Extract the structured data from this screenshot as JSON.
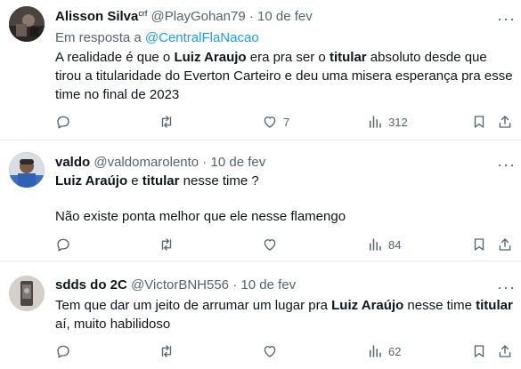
{
  "posts": [
    {
      "name": "Alisson Silva",
      "name_sup": "crf",
      "handle": "@PlayGohan79",
      "dot": "·",
      "date": "10 de fev",
      "reply_prefix": "Em resposta a",
      "reply_to": "@CentralFlaNacao",
      "text_1": "A realidade é que o ",
      "bold_1": "Luiz Araujo",
      "text_2": " era pra ser o ",
      "bold_2": "titular",
      "text_3": " absoluto desde que tirou a titularidade do Everton Carteiro e deu uma misera esperança pra esse time no final de 2023",
      "likes": "7",
      "views": "312"
    },
    {
      "name": "valdo",
      "handle": "@valdomarolento",
      "dot": "·",
      "date": "10 de fev",
      "bold_1": "Luiz Araújo",
      "text_1": " e ",
      "bold_2": "titular",
      "text_2": " nesse time ?",
      "text_3": "Não existe ponta melhor que ele nesse flamengo",
      "views": "84"
    },
    {
      "name": "sdds do 2C",
      "handle": "@VictorBNH556",
      "dot": "·",
      "date": "10 de fev",
      "text_1": "Tem que dar um jeito de arrumar um lugar pra ",
      "bold_1": "Luiz Araújo",
      "text_2": " nesse time ",
      "bold_2": "titular",
      "text_3": " aí, muito habilidoso",
      "views": "62"
    }
  ],
  "more_glyph": "···",
  "icons": {
    "reply": "reply-icon",
    "repost": "repost-icon",
    "like": "like-icon",
    "views": "views-icon",
    "bookmark": "bookmark-icon",
    "share": "share-icon"
  },
  "colors": {
    "text": "#0f1419",
    "secondary": "#536471",
    "link": "#1d9bf0",
    "divider": "#e7e9ea"
  }
}
